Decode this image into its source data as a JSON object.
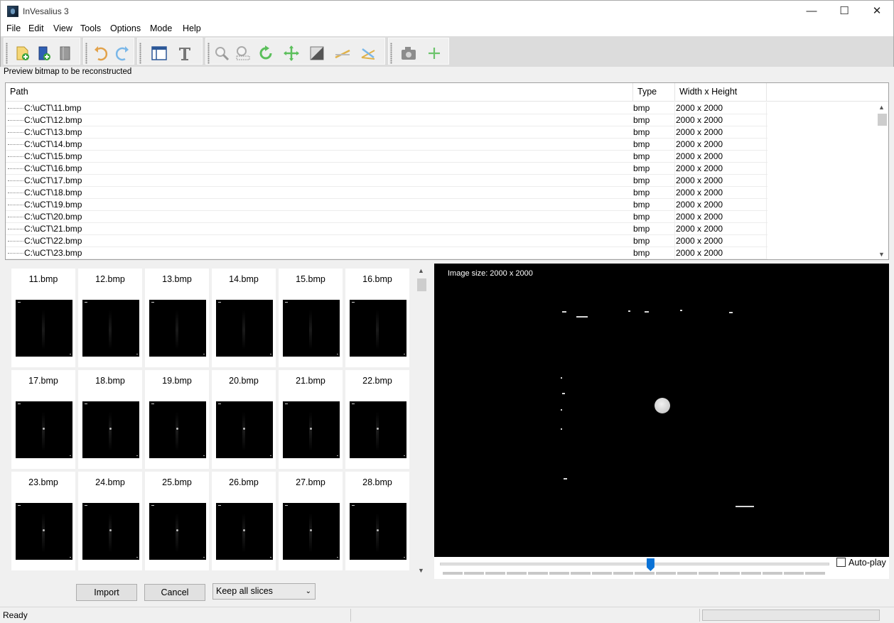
{
  "window": {
    "title": "InVesalius 3",
    "minimize": "—",
    "maximize": "☐",
    "close": "✕"
  },
  "menu": [
    "File",
    "Edit",
    "View",
    "Tools",
    "Options",
    "Mode",
    "Help"
  ],
  "toolbar": {
    "icons": [
      "import-dicom-icon",
      "import-project-icon",
      "close-project-icon",
      "undo-icon",
      "redo-icon",
      "layout-icon",
      "text-icon",
      "zoom-icon",
      "zoom-select-icon",
      "rotate-icon",
      "move-icon",
      "contrast-icon",
      "measure-linear-icon",
      "measure-angle-icon",
      "snapshot-icon",
      "add-icon"
    ]
  },
  "section_label": "Preview bitmap to be reconstructed",
  "file_list": {
    "columns": [
      "Path",
      "Type",
      "Width x Height"
    ],
    "rows": [
      {
        "path": "C:\\uCT\\11.bmp",
        "type": "bmp",
        "size": "2000 x 2000"
      },
      {
        "path": "C:\\uCT\\12.bmp",
        "type": "bmp",
        "size": "2000 x 2000"
      },
      {
        "path": "C:\\uCT\\13.bmp",
        "type": "bmp",
        "size": "2000 x 2000"
      },
      {
        "path": "C:\\uCT\\14.bmp",
        "type": "bmp",
        "size": "2000 x 2000"
      },
      {
        "path": "C:\\uCT\\15.bmp",
        "type": "bmp",
        "size": "2000 x 2000"
      },
      {
        "path": "C:\\uCT\\16.bmp",
        "type": "bmp",
        "size": "2000 x 2000"
      },
      {
        "path": "C:\\uCT\\17.bmp",
        "type": "bmp",
        "size": "2000 x 2000"
      },
      {
        "path": "C:\\uCT\\18.bmp",
        "type": "bmp",
        "size": "2000 x 2000"
      },
      {
        "path": "C:\\uCT\\19.bmp",
        "type": "bmp",
        "size": "2000 x 2000"
      },
      {
        "path": "C:\\uCT\\20.bmp",
        "type": "bmp",
        "size": "2000 x 2000"
      },
      {
        "path": "C:\\uCT\\21.bmp",
        "type": "bmp",
        "size": "2000 x 2000"
      },
      {
        "path": "C:\\uCT\\22.bmp",
        "type": "bmp",
        "size": "2000 x 2000"
      },
      {
        "path": "C:\\uCT\\23.bmp",
        "type": "bmp",
        "size": "2000 x 2000"
      }
    ]
  },
  "thumbnails": [
    {
      "label": "11.bmp",
      "dot": false
    },
    {
      "label": "12.bmp",
      "dot": false
    },
    {
      "label": "13.bmp",
      "dot": false
    },
    {
      "label": "14.bmp",
      "dot": false
    },
    {
      "label": "15.bmp",
      "dot": false
    },
    {
      "label": "16.bmp",
      "dot": false
    },
    {
      "label": "17.bmp",
      "dot": true
    },
    {
      "label": "18.bmp",
      "dot": true
    },
    {
      "label": "19.bmp",
      "dot": true
    },
    {
      "label": "20.bmp",
      "dot": true
    },
    {
      "label": "21.bmp",
      "dot": true
    },
    {
      "label": "22.bmp",
      "dot": true
    },
    {
      "label": "23.bmp",
      "dot": true
    },
    {
      "label": "24.bmp",
      "dot": true
    },
    {
      "label": "25.bmp",
      "dot": true
    },
    {
      "label": "26.bmp",
      "dot": true
    },
    {
      "label": "27.bmp",
      "dot": true
    },
    {
      "label": "28.bmp",
      "dot": true
    }
  ],
  "preview": {
    "caption": "Image size: 2000 x 2000",
    "slider_fraction": 0.54,
    "autoplay_label": "Auto-play",
    "autoplay_checked": false
  },
  "buttons": {
    "import": "Import",
    "cancel": "Cancel"
  },
  "slice_select": {
    "value": "Keep all slices"
  },
  "status": {
    "text": "Ready"
  }
}
